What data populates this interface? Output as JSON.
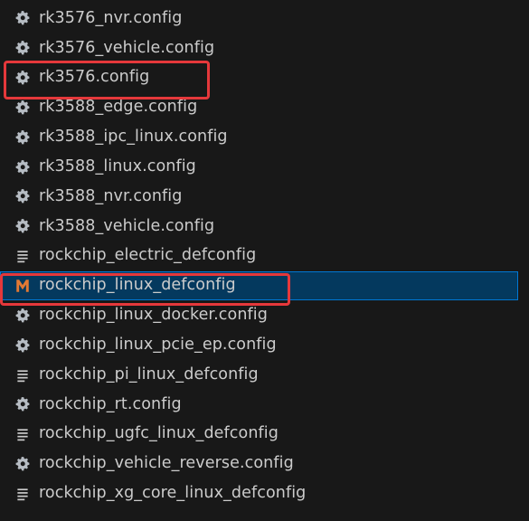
{
  "explorer": {
    "files": [
      {
        "name": "rk3576_nvr.config",
        "icon": "gear-icon"
      },
      {
        "name": "rk3576_vehicle.config",
        "icon": "gear-icon"
      },
      {
        "name": "rk3576.config",
        "icon": "gear-icon",
        "highlighted": true
      },
      {
        "name": "rk3588_edge.config",
        "icon": "gear-icon"
      },
      {
        "name": "rk3588_ipc_linux.config",
        "icon": "gear-icon"
      },
      {
        "name": "rk3588_linux.config",
        "icon": "gear-icon"
      },
      {
        "name": "rk3588_nvr.config",
        "icon": "gear-icon"
      },
      {
        "name": "rk3588_vehicle.config",
        "icon": "gear-icon"
      },
      {
        "name": "rockchip_electric_defconfig",
        "icon": "lines-icon"
      },
      {
        "name": "rockchip_linux_defconfig",
        "icon": "makefile-m-icon",
        "selected": true,
        "highlighted": true
      },
      {
        "name": "rockchip_linux_docker.config",
        "icon": "gear-icon"
      },
      {
        "name": "rockchip_linux_pcie_ep.config",
        "icon": "gear-icon"
      },
      {
        "name": "rockchip_pi_linux_defconfig",
        "icon": "lines-icon"
      },
      {
        "name": "rockchip_rt.config",
        "icon": "gear-icon"
      },
      {
        "name": "rockchip_ugfc_linux_defconfig",
        "icon": "lines-icon"
      },
      {
        "name": "rockchip_vehicle_reverse.config",
        "icon": "gear-icon"
      },
      {
        "name": "rockchip_xg_core_linux_defconfig",
        "icon": "lines-icon"
      }
    ]
  },
  "colors": {
    "background": "#181818",
    "text": "#cccccc",
    "selected_bg": "#04395e",
    "selected_border": "#0078d4",
    "annotation_red": "#e5383b",
    "gear": "#b6bcc3",
    "makefile_orange": "#e37933"
  }
}
